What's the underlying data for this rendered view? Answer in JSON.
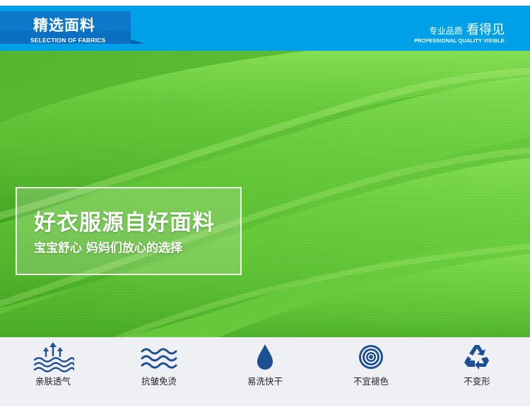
{
  "header": {
    "title": "精选面料",
    "subtitle": "SELECTION OF FABRICS",
    "tagline_small": "专业品质",
    "tagline_big": "看得见",
    "tagline_en": "PROFESSIONAL QUALITY VISIBLE"
  },
  "hero": {
    "headline": "好衣服源自好面料",
    "subline": "宝宝舒心 妈妈们放心的选择"
  },
  "features": [
    {
      "label": "亲肤透气",
      "icon": "breathable-icon"
    },
    {
      "label": "抗皱免烫",
      "icon": "wave-icon"
    },
    {
      "label": "易洗快干",
      "icon": "water-drop-icon"
    },
    {
      "label": "不宜褪色",
      "icon": "target-icon"
    },
    {
      "label": "不变形",
      "icon": "recycle-icon"
    }
  ],
  "colors": {
    "header_blue": "#00a0e9",
    "tab_blue": "#0b6fc1",
    "fabric_green": "#5fc335",
    "icon_navy": "#1d4f95",
    "strip_bg": "#eef0f4"
  }
}
